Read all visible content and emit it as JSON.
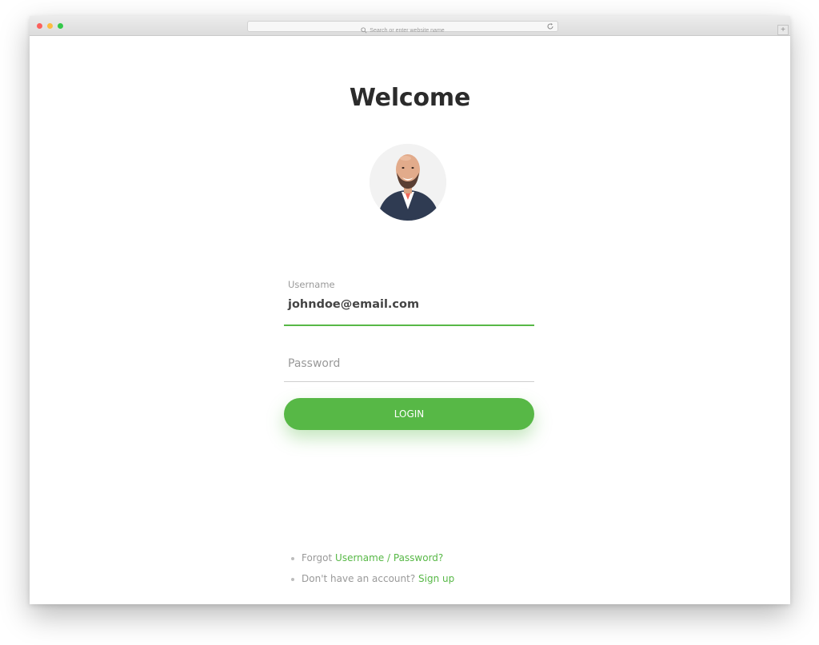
{
  "browser": {
    "address_placeholder": "Search or enter website name",
    "new_tab_label": "+"
  },
  "page": {
    "title": "Welcome",
    "username": {
      "label": "Username",
      "value": "johndoe@email.com"
    },
    "password": {
      "placeholder": "Password"
    },
    "login_label": "LOGIN",
    "links": {
      "forgot_prefix": "Forgot",
      "forgot_link": "Username / Password?",
      "signup_prefix": "Don't have an account?",
      "signup_link": "Sign up"
    }
  },
  "colors": {
    "accent": "#57b846",
    "text_dark": "#2b2b2b",
    "text_muted": "#999999"
  },
  "icons": [
    "search-icon",
    "reload-icon",
    "avatar-photo",
    "bullet-icon"
  ]
}
